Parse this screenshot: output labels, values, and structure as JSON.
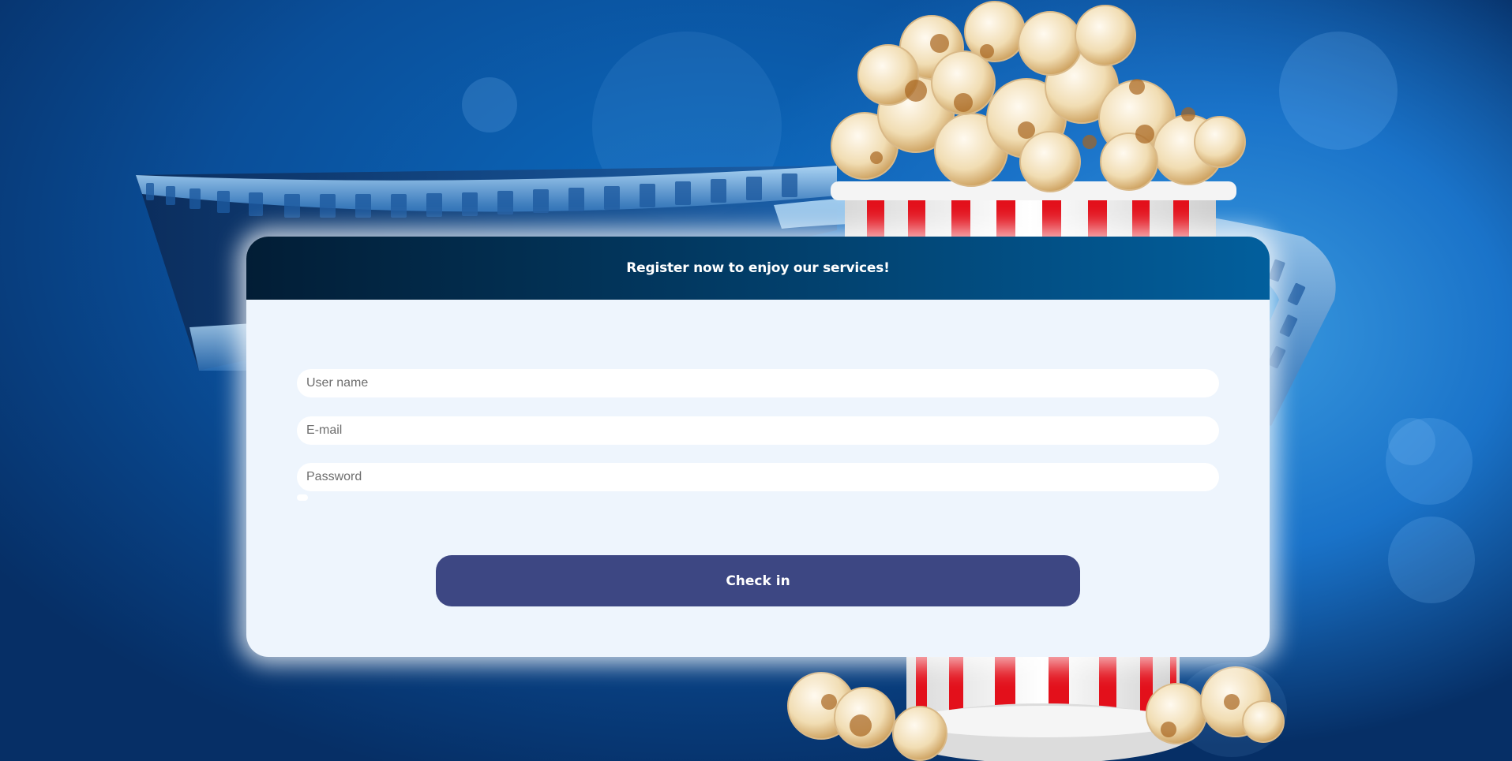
{
  "form": {
    "title": "Register now to enjoy our services!",
    "username_placeholder": "User name",
    "email_placeholder": "E-mail",
    "password_placeholder": "Password",
    "submit_label": "Check in"
  },
  "colors": {
    "background": "#0a4f9a",
    "card": "#eef5fd",
    "header_dark": "#021d35",
    "header_light": "#025f9d",
    "button": "#3d4783",
    "popcorn_stripe": "#e3101b"
  },
  "decorations": {
    "background_icons": [
      "film-strip-icon",
      "popcorn-bucket-icon"
    ]
  }
}
